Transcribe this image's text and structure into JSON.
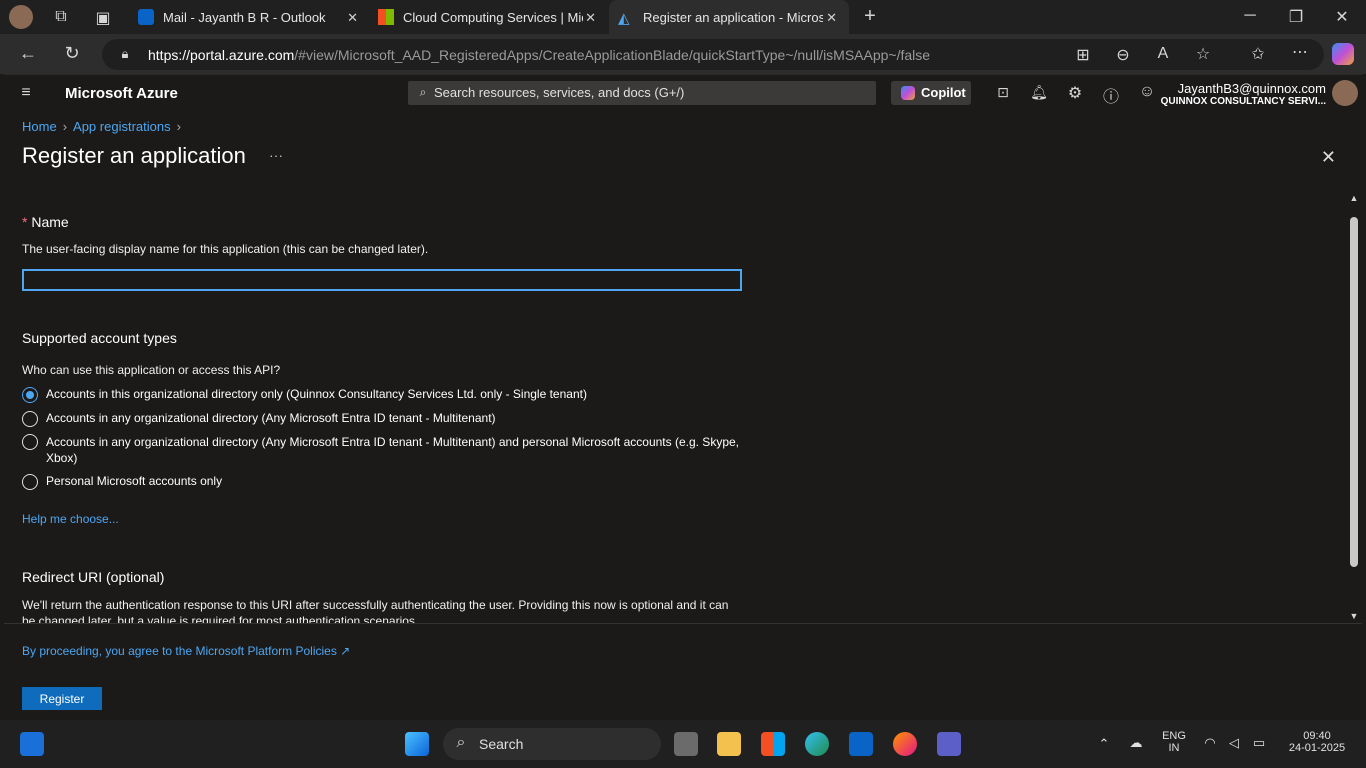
{
  "browser": {
    "tabs": [
      {
        "title": "Mail - Jayanth B R - Outlook",
        "icon": "outlook-icon"
      },
      {
        "title": "Cloud Computing Services | Micro",
        "icon": "microsoft-icon"
      },
      {
        "title": "Register an application - Microsof",
        "icon": "azure-icon",
        "active": true
      }
    ],
    "url_host": "https://portal.azure.com",
    "url_path": "/#view/Microsoft_AAD_RegisteredApps/CreateApplicationBlade/quickStartType~/null/isMSAApp~/false"
  },
  "azure": {
    "brand": "Microsoft Azure",
    "search_placeholder": "Search resources, services, and docs (G+/)",
    "copilot_label": "Copilot",
    "account_email": "JayanthB3@quinnox.com",
    "account_org": "QUINNOX CONSULTANCY SERVI..."
  },
  "page": {
    "breadcrumb": [
      "Home",
      "App registrations"
    ],
    "title": "Register an application",
    "more": "···",
    "name_section": {
      "required_marker": "*",
      "label": "Name",
      "description": "The user-facing display name for this application (this can be changed later).",
      "value": ""
    },
    "account_types": {
      "heading": "Supported account types",
      "question": "Who can use this application or access this API?",
      "options": [
        {
          "label": "Accounts in this organizational directory only (Quinnox Consultancy Services Ltd. only - Single tenant)",
          "selected": true
        },
        {
          "label": "Accounts in any organizational directory (Any Microsoft Entra ID tenant - Multitenant)",
          "selected": false
        },
        {
          "label": "Accounts in any organizational directory (Any Microsoft Entra ID tenant - Multitenant) and personal Microsoft accounts (e.g. Skype, Xbox)",
          "selected": false
        },
        {
          "label": "Personal Microsoft accounts only",
          "selected": false
        }
      ],
      "help_link": "Help me choose..."
    },
    "redirect": {
      "heading": "Redirect URI (optional)",
      "description": "We'll return the authentication response to this URI after successfully authenticating the user. Providing this now is optional and it can be changed later, but a value is required for most authentication scenarios."
    },
    "policy_link": "By proceeding, you agree to the Microsoft Platform Policies",
    "register_label": "Register"
  },
  "taskbar": {
    "search_label": "Search",
    "lang_top": "ENG",
    "lang_bottom": "IN",
    "time": "09:40",
    "date": "24-01-2025"
  },
  "colors": {
    "accent": "#4ea6f1",
    "button": "#0f6cbd",
    "background": "#1b1a19"
  }
}
